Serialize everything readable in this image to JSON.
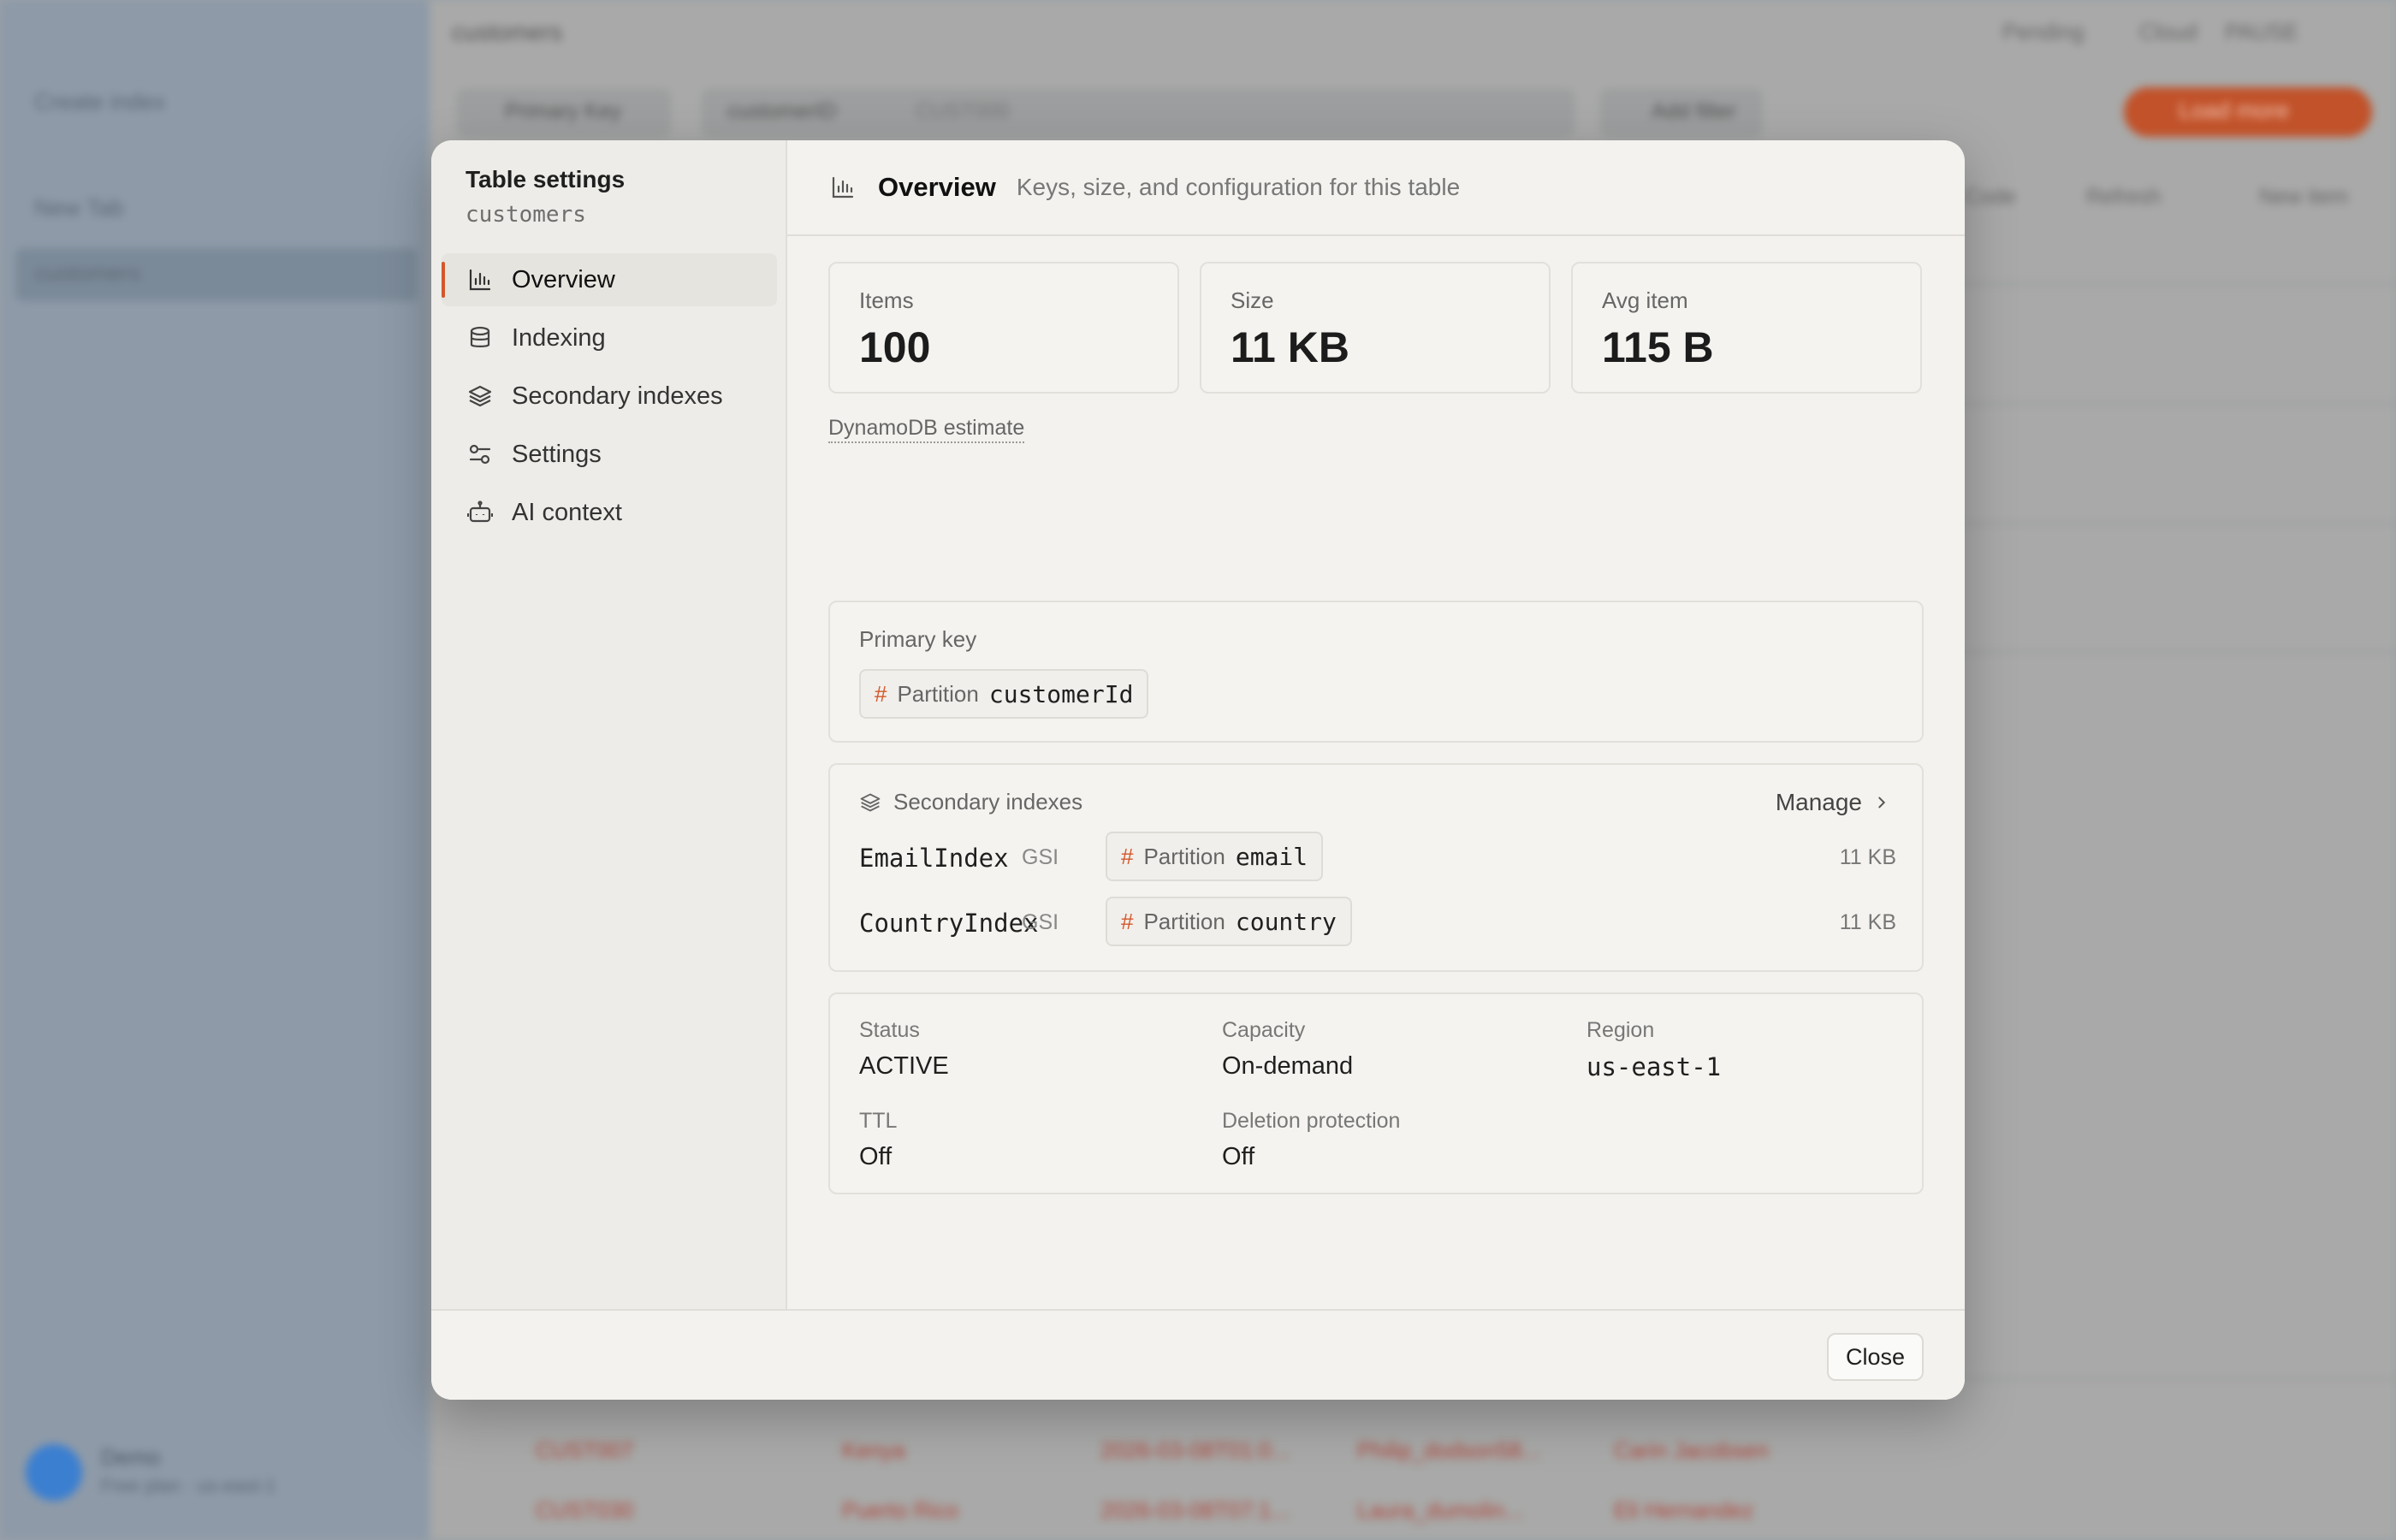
{
  "background": {
    "sidebar": {
      "items": [
        "Create index",
        "New Tab",
        "customers"
      ],
      "user_name": "Demo",
      "user_sub": "Free plan · us-east-1"
    },
    "title": "customers",
    "top_right": [
      "Pending",
      "Cloud",
      "PAUSE"
    ],
    "toolbar": {
      "key_select": "Primary Key",
      "key_field": "customerID",
      "key_value": "CUST000",
      "add_filter": "Add filter",
      "load": "Load more",
      "code": "Code",
      "refresh": "Refresh",
      "new_item": "New item"
    },
    "rows": [
      [
        "CUST007",
        "Kenya",
        "2026-03-08T01:0...",
        "Philip_dodson58...",
        "Carin Jacobsen"
      ],
      [
        "CUST030",
        "Puerto Rico",
        "2026-03-08T07:1...",
        "Laura_dumolin...",
        "Eli Hernandez"
      ]
    ]
  },
  "modal": {
    "sidebar": {
      "title": "Table settings",
      "table_name": "customers",
      "nav": [
        {
          "label": "Overview",
          "icon": "bar-chart-icon",
          "active": true
        },
        {
          "label": "Indexing",
          "icon": "database-icon",
          "active": false
        },
        {
          "label": "Secondary indexes",
          "icon": "layers-icon",
          "active": false
        },
        {
          "label": "Settings",
          "icon": "sliders-icon",
          "active": false
        },
        {
          "label": "AI context",
          "icon": "robot-icon",
          "active": false
        }
      ]
    },
    "header": {
      "title": "Overview",
      "subtitle": "Keys, size, and configuration for this table"
    },
    "stats": [
      {
        "label": "Items",
        "value": "100"
      },
      {
        "label": "Size",
        "value": "11 KB"
      },
      {
        "label": "Avg item",
        "value": "115 B"
      }
    ],
    "estimate_note": "DynamoDB estimate",
    "primary_key": {
      "label": "Primary key",
      "hash": "#",
      "type": "Partition",
      "name": "customerId"
    },
    "secondary_indexes": {
      "label": "Secondary indexes",
      "manage": "Manage",
      "items": [
        {
          "name": "EmailIndex",
          "kind": "GSI",
          "hash": "#",
          "key_type": "Partition",
          "key_name": "email",
          "size": "11 KB"
        },
        {
          "name": "CountryIndex",
          "kind": "GSI",
          "hash": "#",
          "key_type": "Partition",
          "key_name": "country",
          "size": "11 KB"
        }
      ]
    },
    "meta": {
      "status_label": "Status",
      "status_value": "ACTIVE",
      "capacity_label": "Capacity",
      "capacity_value": "On-demand",
      "region_label": "Region",
      "region_value": "us-east-1",
      "ttl_label": "TTL",
      "ttl_value": "Off",
      "deletion_label": "Deletion protection",
      "deletion_value": "Off"
    },
    "footer": {
      "close": "Close"
    }
  },
  "colors": {
    "accent": "#d4572a",
    "modal_bg": "#f3f2ee",
    "sidebar_bg": "#edece8"
  }
}
